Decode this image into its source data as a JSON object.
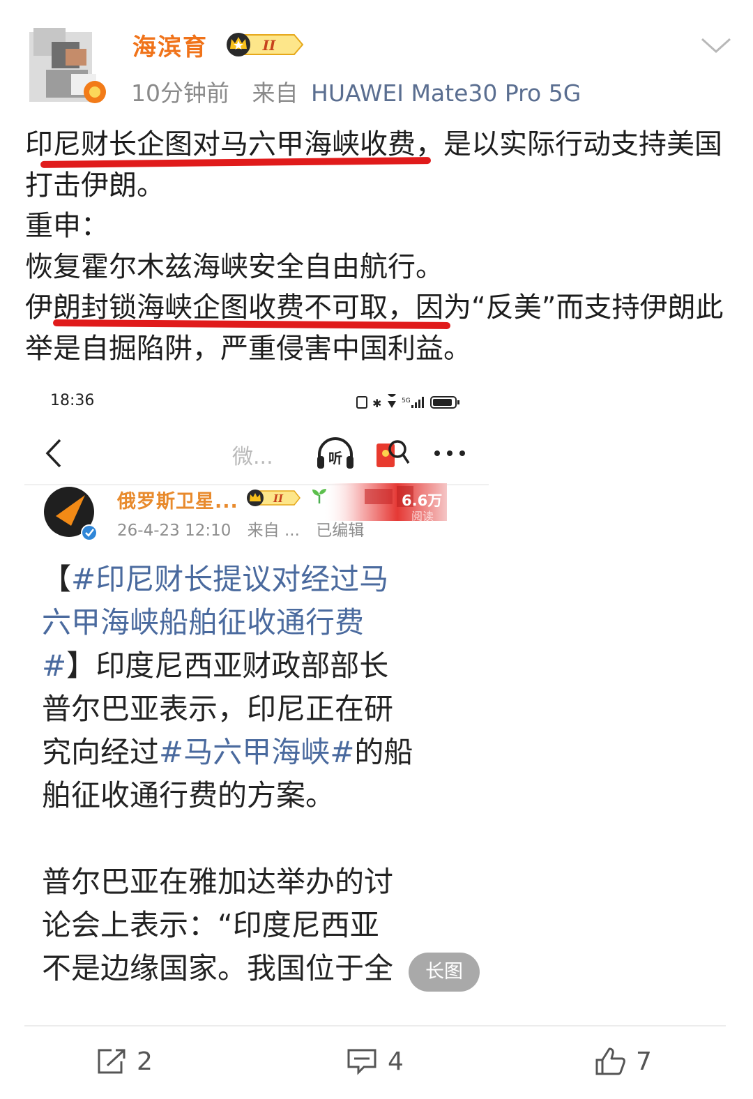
{
  "post": {
    "username": "海滨育",
    "vip_level": "II",
    "time_ago": "10分钟前",
    "source_prefix": "来自",
    "device": "HUAWEI Mate30 Pro 5G",
    "text_lines": [
      "印尼财长企图对马六甲海峡收费，是以实际行动支持美国打击伊朗。",
      "重申：",
      "恢复霍尔木兹海峡安全自由航行。",
      "伊朗封锁海峡企图收费不可取，因为“反美”而支持伊朗此举是自掘陷阱，严重侵害中国利益。"
    ]
  },
  "embedded": {
    "status_time": "18:36",
    "nav_title": "微...",
    "account_name": "俄罗斯卫星...",
    "badge_level": "II",
    "read_count": "6.6万",
    "read_label": "阅读",
    "post_date": "26-4-23 12:10",
    "source": "来自 ...",
    "edited": "已编辑",
    "body": {
      "l1_bracket_open": "【",
      "l1_topic": "#印尼财长提议对经过马",
      "l2_topic": "六甲海峡船舶征收通行费",
      "l3_topic": "#",
      "l3_text": "】印度尼西亚财政部部长",
      "l4": "普尔巴亚表示，印尼正在研",
      "l5_pre": "究向经过",
      "l5_topic": "#马六甲海峡#",
      "l5_post": "的船",
      "l6": "舶征收通行费的方案。",
      "l7": "普尔巴亚在雅加达举办的讨",
      "l8": "论会上表示：“印度尼西亚",
      "l9": "不是边缘国家。我国位于全"
    },
    "long_image_tag": "长图"
  },
  "actions": {
    "repost_count": "2",
    "comment_count": "4",
    "like_count": "7"
  },
  "colors": {
    "underline_red": "#e01b1b",
    "topic_blue": "#4a6a9e",
    "username_orange": "#f0731a"
  }
}
